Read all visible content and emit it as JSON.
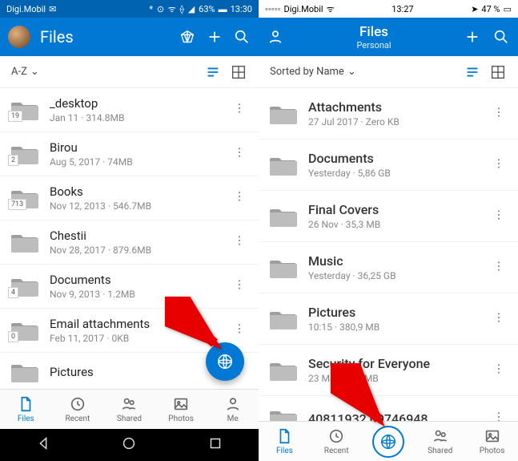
{
  "left": {
    "status": {
      "carrier": "Digi.Mobil",
      "battery": "63%",
      "time": "13:30"
    },
    "header": {
      "title": "Files"
    },
    "sort": {
      "label": "A-Z"
    },
    "items": [
      {
        "name": "_desktop",
        "meta": "Jan 11 · 314.8MB",
        "badge": "19"
      },
      {
        "name": "Birou",
        "meta": "Aug 5, 2017 · 74MB",
        "badge": "2"
      },
      {
        "name": "Books",
        "meta": "Nov 12, 2013 · 546.7MB",
        "badge": "713"
      },
      {
        "name": "Chestii",
        "meta": "Nov 28, 2017 · 879.6MB",
        "badge": ""
      },
      {
        "name": "Documents",
        "meta": "Nov 9, 2013 · 1.2MB",
        "badge": "4"
      },
      {
        "name": "Email attachments",
        "meta": "Feb 11, 2017 · 0KB",
        "badge": "0"
      },
      {
        "name": "Pictures",
        "meta": "",
        "badge": ""
      }
    ],
    "tabs": [
      {
        "label": "Files"
      },
      {
        "label": "Recent"
      },
      {
        "label": "Shared"
      },
      {
        "label": "Photos"
      },
      {
        "label": "Me"
      }
    ]
  },
  "right": {
    "status": {
      "carrier": "Digi.Mobil",
      "time": "13:27",
      "battery": "47 %"
    },
    "header": {
      "title": "Files",
      "subtitle": "Personal"
    },
    "sort": {
      "label": "Sorted by Name"
    },
    "items": [
      {
        "name": "Attachments",
        "meta": "27 Jul 2017 · Zero KB"
      },
      {
        "name": "Documents",
        "meta": "Yesterday · 5,86 GB"
      },
      {
        "name": "Final Covers",
        "meta": "26 Nov · 35,3 MB"
      },
      {
        "name": "Music",
        "meta": "Yesterday · 36,25 GB"
      },
      {
        "name": "Pictures",
        "meta": "10:15 · 380,9 MB"
      },
      {
        "name": "Security for Everyone",
        "meta": "23 Mar · 158 MB"
      },
      {
        "name": "40811932 09746948",
        "meta": ""
      }
    ],
    "tabs": [
      {
        "label": "Files"
      },
      {
        "label": "Recent"
      },
      {
        "label": ""
      },
      {
        "label": "Shared"
      },
      {
        "label": "Photos"
      }
    ]
  }
}
